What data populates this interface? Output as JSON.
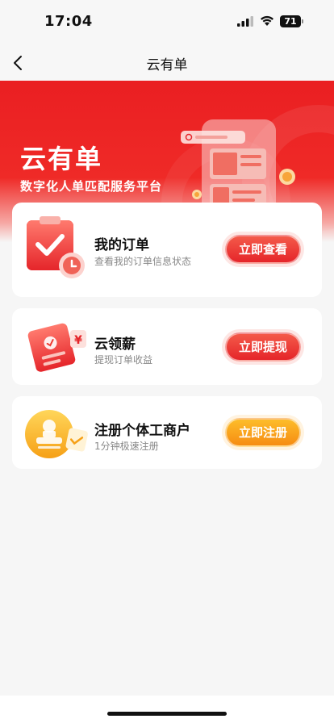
{
  "status_bar": {
    "time": "17:04",
    "battery": "71"
  },
  "nav": {
    "title": "云有单"
  },
  "hero": {
    "title": "云有单",
    "subtitle": "数字化人单匹配服务平台"
  },
  "cards": [
    {
      "title": "我的订单",
      "desc": "查看我的订单信息状态",
      "button": "立即查看"
    },
    {
      "title": "云领薪",
      "desc": "提现订单收益",
      "button": "立即提现"
    },
    {
      "title": "注册个体工商户",
      "desc": "1分钟极速注册",
      "button": "立即注册"
    }
  ],
  "icons": {
    "back": "chevron-left-icon",
    "orders": "clipboard-check-icon",
    "salary": "yuan-document-icon",
    "register": "stamp-icon"
  },
  "colors": {
    "brand_red": "#e5252a",
    "accent_orange": "#f68c12",
    "background": "#f6f6f6"
  }
}
